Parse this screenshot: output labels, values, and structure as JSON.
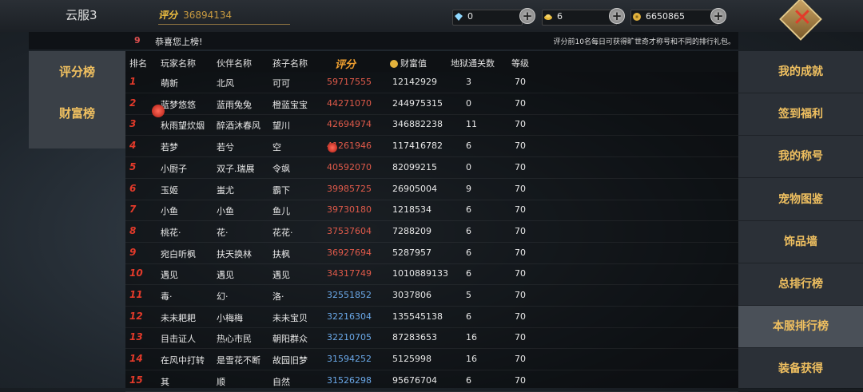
{
  "header": {
    "server": "云服3",
    "score_label": "评分",
    "score_value": "36894134",
    "diamonds": "0",
    "gold_ingots": "6",
    "coins": "6650865"
  },
  "announcement": {
    "rank": "9",
    "text": "恭喜您上榜!",
    "note": "评分前10名每日可获得旷世奇才称号和不同的排行礼包。"
  },
  "left_tabs": [
    "评分榜",
    "财富榜"
  ],
  "table": {
    "headers": [
      "排名",
      "玩家名称",
      "伙伴名称",
      "孩子名称",
      "评分",
      "财富值",
      "地狱通关数",
      "等级"
    ],
    "rows": [
      {
        "rank": "1",
        "player": "萌新",
        "partner": "北风",
        "child": "可可",
        "score": "59717555",
        "wealth": "12142929",
        "hell": "3",
        "level": "70"
      },
      {
        "rank": "2",
        "player": "蓝梦悠悠",
        "partner": "蓝雨兔兔",
        "child": "橙蓝宝宝",
        "score": "44271070",
        "wealth": "244975315",
        "hell": "0",
        "level": "70"
      },
      {
        "rank": "3",
        "player": "秋雨望炊烟",
        "partner": "醉酒沐春风",
        "child": "望川",
        "score": "42694974",
        "wealth": "346882238",
        "hell": "11",
        "level": "70"
      },
      {
        "rank": "4",
        "player": "若梦",
        "partner": "若兮",
        "child": "空",
        "score": "41261946",
        "wealth": "117416782",
        "hell": "6",
        "level": "70"
      },
      {
        "rank": "5",
        "player": "小厨子",
        "partner": "双子.瑞展",
        "child": "令飒",
        "score": "40592070",
        "wealth": "82099215",
        "hell": "0",
        "level": "70"
      },
      {
        "rank": "6",
        "player": "玉姬",
        "partner": "蚩尤",
        "child": "霸下",
        "score": "39985725",
        "wealth": "26905004",
        "hell": "9",
        "level": "70"
      },
      {
        "rank": "7",
        "player": "小鱼",
        "partner": "小鱼",
        "child": "鱼儿",
        "score": "39730180",
        "wealth": "1218534",
        "hell": "6",
        "level": "70"
      },
      {
        "rank": "8",
        "player": "桃花·",
        "partner": "花·",
        "child": "花花·",
        "score": "37537604",
        "wealth": "7288209",
        "hell": "6",
        "level": "70"
      },
      {
        "rank": "9",
        "player": "宛白听枫",
        "partner": "扶天换林",
        "child": "扶枫",
        "score": "36927694",
        "wealth": "5287957",
        "hell": "6",
        "level": "70"
      },
      {
        "rank": "10",
        "player": "遇见",
        "partner": "遇见",
        "child": "遇见",
        "score": "34317749",
        "wealth": "1010889133",
        "hell": "6",
        "level": "70"
      },
      {
        "rank": "11",
        "player": "毒·",
        "partner": "幻·",
        "child": "洛·",
        "score": "32551852",
        "wealth": "3037806",
        "hell": "5",
        "level": "70"
      },
      {
        "rank": "12",
        "player": "未未耙耙",
        "partner": "小梅梅",
        "child": "未未宝贝",
        "score": "32216304",
        "wealth": "135545138",
        "hell": "6",
        "level": "70"
      },
      {
        "rank": "13",
        "player": "目击证人",
        "partner": "热心市民",
        "child": "朝阳群众",
        "score": "32210705",
        "wealth": "87283653",
        "hell": "16",
        "level": "70"
      },
      {
        "rank": "14",
        "player": "在风中打转",
        "partner": "是雪花不断",
        "child": "故园旧梦",
        "score": "31594252",
        "wealth": "5125998",
        "hell": "16",
        "level": "70"
      },
      {
        "rank": "15",
        "player": "其",
        "partner": "顺",
        "child": "自然",
        "score": "31526298",
        "wealth": "95676704",
        "hell": "6",
        "level": "70"
      }
    ]
  },
  "right_menu": [
    "我的成就",
    "签到福利",
    "我的称号",
    "宠物图鉴",
    "饰品墙",
    "总排行榜",
    "本服排行榜",
    "装备获得"
  ],
  "colors": {
    "accent": "#f0c060",
    "rank": "#e23a2a",
    "score_top": "#e05a4a",
    "score_low": "#6aa8e8"
  }
}
